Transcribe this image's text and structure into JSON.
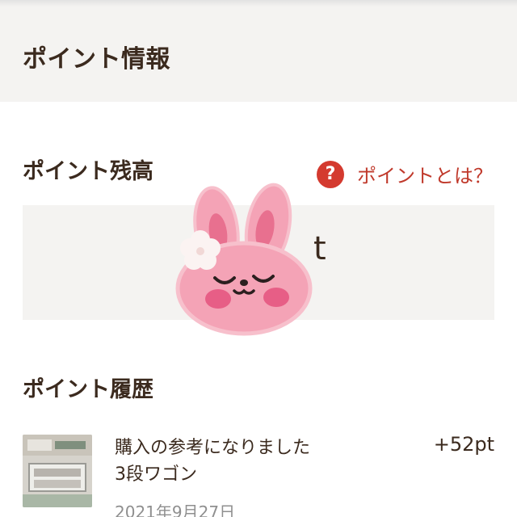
{
  "header": {
    "title": "ポイント情報"
  },
  "balance": {
    "title": "ポイント残高",
    "help_link": "ポイントとは？",
    "help_icon": "question-icon",
    "unit": "t"
  },
  "history": {
    "title": "ポイント履歴",
    "items": [
      {
        "description_line1": "購入の参考になりました",
        "description_line2": "3段ワゴン",
        "points": "+52pt",
        "date": "2021年9月27日"
      }
    ]
  },
  "colors": {
    "accent_red": "#c0392b",
    "text": "#3b2a1e",
    "panel_bg": "#f4f3f1"
  }
}
